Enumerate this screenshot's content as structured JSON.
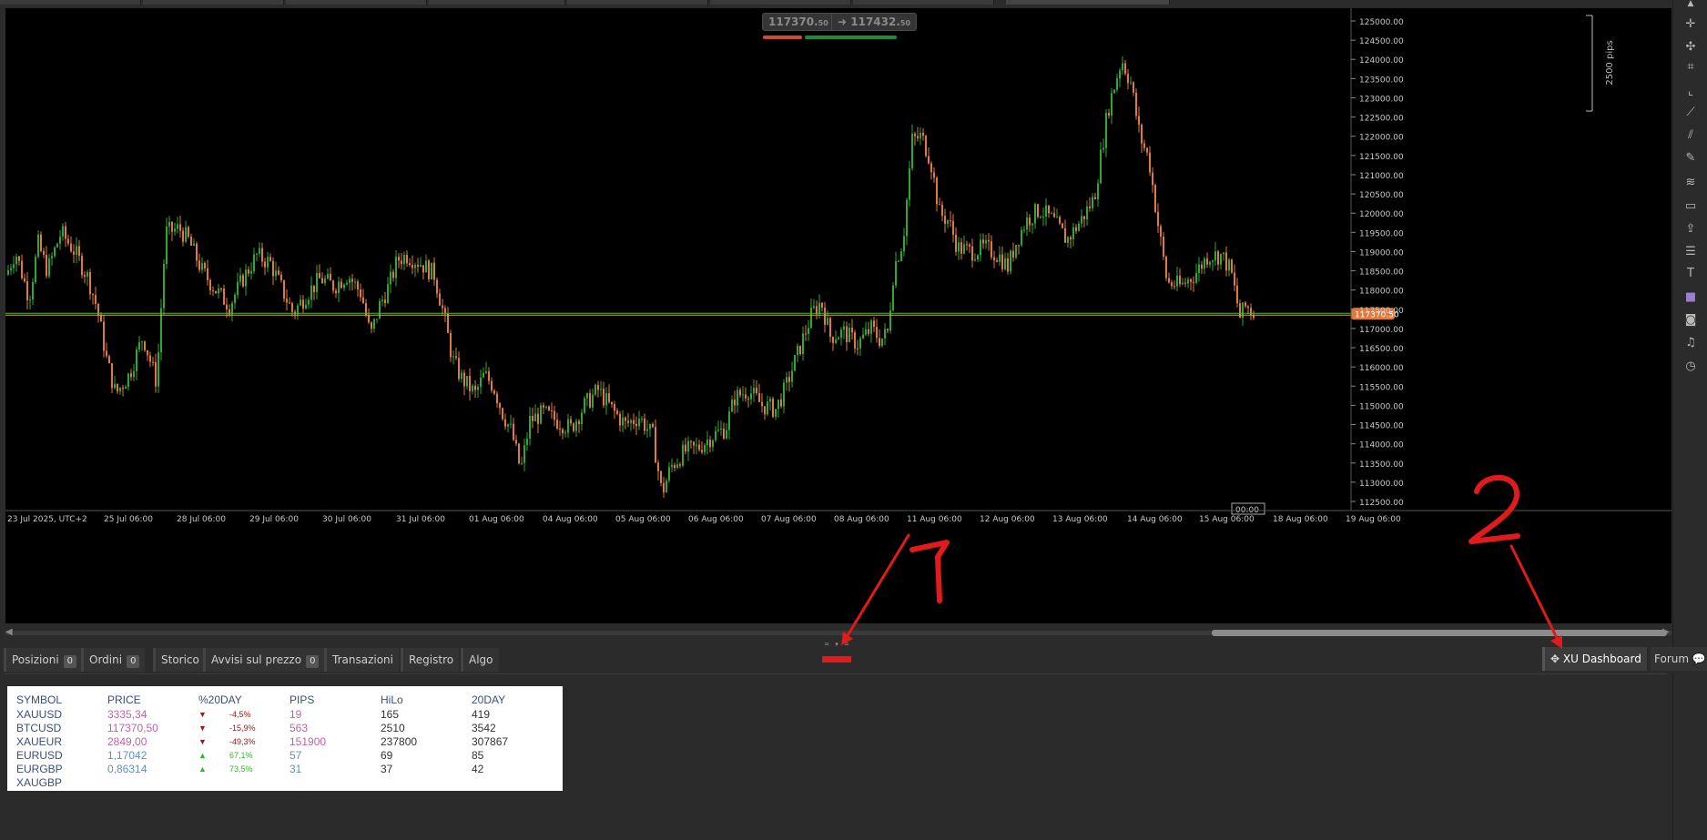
{
  "colors": {
    "bull": "#2ea82e",
    "bear": "#e07a3c",
    "price_line": "#d9a93a",
    "price_line2": "#4fb34f",
    "price_tag": "#e07a3c",
    "annotation": "#e11b1b",
    "magenta": "#c062a8",
    "blue": "#5f8fc8",
    "down": "#a01818",
    "up": "#2fb82f"
  },
  "quotes": {
    "sell": "117370.",
    "sell_small": "50",
    "buy": "117432.",
    "buy_small": "50",
    "sell_arrow": "➜",
    "buy_arrow": "➜"
  },
  "chart": {
    "pips_label": "2500 pips",
    "current_price": "117370.50",
    "timer": "00:00",
    "y_ticks": [
      "125000.00",
      "124500.00",
      "124000.00",
      "123500.00",
      "123000.00",
      "122500.00",
      "122000.00",
      "121500.00",
      "121000.00",
      "120500.00",
      "120000.00",
      "119500.00",
      "119000.00",
      "118500.00",
      "118000.00",
      "117500.00",
      "117000.00",
      "116500.00",
      "116000.00",
      "115500.00",
      "115000.00",
      "114500.00",
      "114000.00",
      "113500.00",
      "113000.00",
      "112500.00"
    ],
    "x_ticks": [
      "23 Jul 2025, UTC+2",
      "25 Jul 06:00",
      "28 Jul 06:00",
      "29 Jul 06:00",
      "30 Jul 06:00",
      "31 Jul 06:00",
      "01 Aug 06:00",
      "04 Aug 06:00",
      "05 Aug 06:00",
      "06 Aug 06:00",
      "07 Aug 06:00",
      "08 Aug 06:00",
      "11 Aug 06:00",
      "12 Aug 06:00",
      "13 Aug 06:00",
      "14 Aug 06:00",
      "15 Aug 06:00",
      "18 Aug 06:00",
      "19 Aug 06:00"
    ],
    "close_path": [
      [
        0,
        118400
      ],
      [
        10,
        119000
      ],
      [
        25,
        117800
      ],
      [
        35,
        119200
      ],
      [
        45,
        118500
      ],
      [
        60,
        119500
      ],
      [
        75,
        119000
      ],
      [
        90,
        118300
      ],
      [
        100,
        117500
      ],
      [
        110,
        116200
      ],
      [
        120,
        115300
      ],
      [
        135,
        115800
      ],
      [
        150,
        116800
      ],
      [
        165,
        115600
      ],
      [
        175,
        119500
      ],
      [
        190,
        119600
      ],
      [
        200,
        119300
      ],
      [
        215,
        118500
      ],
      [
        230,
        118000
      ],
      [
        245,
        117600
      ],
      [
        260,
        118300
      ],
      [
        275,
        118900
      ],
      [
        290,
        118700
      ],
      [
        305,
        117900
      ],
      [
        315,
        117400
      ],
      [
        330,
        117900
      ],
      [
        345,
        118300
      ],
      [
        360,
        118100
      ],
      [
        375,
        118400
      ],
      [
        390,
        117900
      ],
      [
        400,
        116800
      ],
      [
        410,
        117600
      ],
      [
        420,
        118100
      ],
      [
        430,
        118800
      ],
      [
        440,
        118900
      ],
      [
        455,
        118700
      ],
      [
        470,
        118400
      ],
      [
        480,
        117400
      ],
      [
        490,
        116200
      ],
      [
        500,
        115700
      ],
      [
        515,
        115300
      ],
      [
        525,
        115800
      ],
      [
        535,
        115500
      ],
      [
        545,
        114800
      ],
      [
        555,
        114300
      ],
      [
        565,
        113300
      ],
      [
        575,
        114600
      ],
      [
        590,
        114800
      ],
      [
        605,
        114600
      ],
      [
        620,
        114400
      ],
      [
        635,
        115000
      ],
      [
        650,
        115400
      ],
      [
        665,
        114900
      ],
      [
        680,
        114500
      ],
      [
        695,
        114700
      ],
      [
        710,
        114200
      ],
      [
        720,
        112700
      ],
      [
        730,
        113400
      ],
      [
        745,
        113800
      ],
      [
        760,
        113900
      ],
      [
        775,
        114200
      ],
      [
        790,
        114400
      ],
      [
        800,
        115200
      ],
      [
        815,
        115400
      ],
      [
        830,
        115000
      ],
      [
        845,
        114900
      ],
      [
        855,
        115400
      ],
      [
        870,
        116400
      ],
      [
        885,
        117400
      ],
      [
        895,
        117700
      ],
      [
        905,
        116800
      ],
      [
        920,
        116900
      ],
      [
        935,
        116600
      ],
      [
        950,
        117000
      ],
      [
        960,
        116700
      ],
      [
        968,
        116900
      ],
      [
        975,
        118600
      ],
      [
        985,
        119300
      ],
      [
        995,
        121900
      ],
      [
        1005,
        122000
      ],
      [
        1015,
        121400
      ],
      [
        1025,
        120000
      ],
      [
        1035,
        119800
      ],
      [
        1045,
        119100
      ],
      [
        1060,
        119000
      ],
      [
        1075,
        119100
      ],
      [
        1090,
        118900
      ],
      [
        1100,
        118600
      ],
      [
        1110,
        119300
      ],
      [
        1120,
        119800
      ],
      [
        1135,
        120100
      ],
      [
        1150,
        119800
      ],
      [
        1165,
        119300
      ],
      [
        1180,
        119800
      ],
      [
        1195,
        120400
      ],
      [
        1210,
        122700
      ],
      [
        1225,
        124000
      ],
      [
        1235,
        123400
      ],
      [
        1245,
        122000
      ],
      [
        1255,
        121400
      ],
      [
        1265,
        119700
      ],
      [
        1275,
        118200
      ],
      [
        1290,
        118100
      ],
      [
        1305,
        118400
      ],
      [
        1320,
        118900
      ],
      [
        1335,
        118900
      ],
      [
        1345,
        118500
      ],
      [
        1355,
        117300
      ],
      [
        1362,
        117600
      ],
      [
        1370,
        117370
      ]
    ]
  },
  "tabs": [
    {
      "label": "Posizioni",
      "badge": "0"
    },
    {
      "label": "Ordini",
      "badge": "0"
    },
    {
      "label": "Storico",
      "badge": ""
    },
    {
      "label": "Avvisi sul prezzo",
      "badge": "0"
    },
    {
      "label": "Transazioni",
      "badge": ""
    },
    {
      "label": "Registro",
      "badge": ""
    },
    {
      "label": "Algo",
      "badge": ""
    }
  ],
  "right_tabs": {
    "dashboard": "XU Dashboard",
    "forum": "Forum"
  },
  "dashboard": {
    "headers": [
      "SYMBOL",
      "PRICE",
      "%20DAY",
      "PIPS",
      "HiLo",
      "20DAY"
    ],
    "rows": [
      {
        "symbol": "XAUUSD",
        "price": "3335,34",
        "dir": "▼",
        "pct": "-4,5%",
        "pips": "19",
        "hilo": "165",
        "d20": "419",
        "tone": "down"
      },
      {
        "symbol": "BTCUSD",
        "price": "117370,50",
        "dir": "▼",
        "pct": "-15,9%",
        "pips": "563",
        "hilo": "2510",
        "d20": "3542",
        "tone": "down"
      },
      {
        "symbol": "XAUEUR",
        "price": "2849,00",
        "dir": "▼",
        "pct": "-49,3%",
        "pips": "151900",
        "hilo": "237800",
        "d20": "307867",
        "tone": "down"
      },
      {
        "symbol": "EURUSD",
        "price": "1,17042",
        "dir": "▲",
        "pct": "67,1%",
        "pips": "57",
        "hilo": "69",
        "d20": "85",
        "tone": "up"
      },
      {
        "symbol": "EURGBP",
        "price": "0,86314",
        "dir": "▲",
        "pct": "73,5%",
        "pips": "31",
        "hilo": "37",
        "d20": "42",
        "tone": "up"
      },
      {
        "symbol": "XAUGBP",
        "price": "",
        "dir": "",
        "pct": "",
        "pips": "",
        "hilo": "",
        "d20": "",
        "tone": "none"
      }
    ]
  },
  "annotations": {
    "one": "1",
    "two": "2"
  }
}
